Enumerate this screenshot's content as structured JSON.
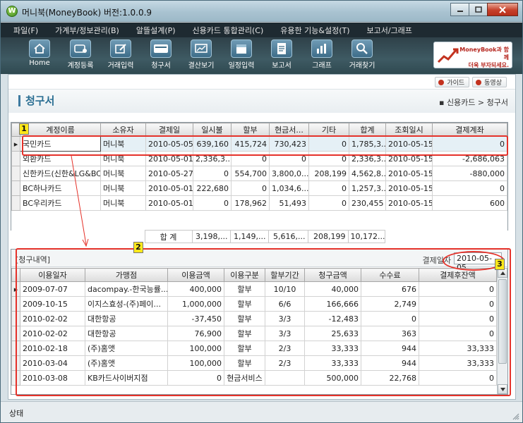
{
  "window": {
    "logo_letter": "W",
    "title": "머니북(MoneyBook) 버전:1.0.0.9"
  },
  "menu": [
    {
      "label": "파일(F)"
    },
    {
      "label": "가계부/정보관리(B)"
    },
    {
      "label": "알뜰설계(P)"
    },
    {
      "label": "신용카드 통합관리(C)"
    },
    {
      "label": "유용한 기능&설정(T)"
    },
    {
      "label": "보고서/그래프"
    }
  ],
  "toolbar": [
    {
      "label": "Home",
      "icon": "home-icon"
    },
    {
      "label": "계정등록",
      "icon": "account-register-icon"
    },
    {
      "label": "거래입력",
      "icon": "edit-icon"
    },
    {
      "label": "청구서",
      "icon": "card-icon"
    },
    {
      "label": "결산보기",
      "icon": "monitor-icon"
    },
    {
      "label": "일정입력",
      "icon": "calendar-icon"
    },
    {
      "label": "보고서",
      "icon": "report-icon"
    },
    {
      "label": "그래프",
      "icon": "bar-chart-icon"
    },
    {
      "label": "거래찾기",
      "icon": "search-icon"
    }
  ],
  "banner": {
    "line1": "MoneyBook과 함께",
    "line2": "더욱 부자되세요."
  },
  "help": {
    "guide": "가이드",
    "video": "동영상"
  },
  "page": {
    "title": "청구서",
    "breadcrumb": "신용카드 > 청구서"
  },
  "bills": {
    "headers": [
      "계정이름",
      "소유자",
      "결제일",
      "일시불",
      "할부",
      "현금서...",
      "기타",
      "합계",
      "조회일시",
      "결제계좌"
    ],
    "rows": [
      [
        "국민카드",
        "머니북",
        "2010-05-05",
        "639,160",
        "415,724",
        "730,423",
        "0",
        "1,785,3...",
        "2010-05-15",
        "0"
      ],
      [
        "외환카드",
        "머니북",
        "2010-05-01",
        "2,336,3...",
        "0",
        "0",
        "0",
        "2,336,3...",
        "2010-05-15",
        "-2,686,063"
      ],
      [
        "신한카드(신한&LG&BC)",
        "머니북",
        "2010-05-27",
        "0",
        "554,700",
        "3,800,0...",
        "208,199",
        "4,562,8...",
        "2010-05-15",
        "-880,000"
      ],
      [
        "BC하나카드",
        "머니북",
        "2010-05-01",
        "222,680",
        "0",
        "1,034,6...",
        "0",
        "1,257,3...",
        "2010-05-15",
        "0"
      ],
      [
        "BC우리카드",
        "머니북",
        "2010-05-01",
        "0",
        "178,962",
        "51,493",
        "0",
        "230,455",
        "2010-05-15",
        "600"
      ]
    ],
    "totals": {
      "label": "합 계",
      "values": [
        "3,198,...",
        "1,149,...",
        "5,616,...",
        "208,199",
        "10,172..."
      ]
    }
  },
  "details": {
    "title": "[청구내역]",
    "due_label": "결제일자",
    "due_date": "2010-05-05",
    "headers": [
      "이용일자",
      "가맹점",
      "이용금액",
      "이용구분",
      "할부기간",
      "청구금액",
      "수수료",
      "결제후잔액"
    ],
    "rows": [
      [
        "2009-07-07",
        "dacompay.-한국능률...",
        "400,000",
        "할부",
        "10/10",
        "40,000",
        "676",
        "0"
      ],
      [
        "2009-10-15",
        "이지스효성-(주)페이...",
        "1,000,000",
        "할부",
        "6/6",
        "166,666",
        "2,749",
        "0"
      ],
      [
        "2010-02-02",
        "대한항공",
        "-37,450",
        "할부",
        "3/3",
        "-12,483",
        "0",
        "0"
      ],
      [
        "2010-02-02",
        "대한항공",
        "76,900",
        "할부",
        "3/3",
        "25,633",
        "363",
        "0"
      ],
      [
        "2010-02-18",
        "(주)홈앳",
        "100,000",
        "할부",
        "2/3",
        "33,333",
        "944",
        "33,333"
      ],
      [
        "2010-03-04",
        "(주)홈앳",
        "100,000",
        "할부",
        "2/3",
        "33,333",
        "944",
        "33,333"
      ],
      [
        "2010-03-08",
        "KB카드사이버지점",
        "0",
        "현금서비스",
        "",
        "500,000",
        "22,768",
        "0"
      ]
    ]
  },
  "status": {
    "text": "상태"
  },
  "annotations": [
    "1",
    "2",
    "3"
  ],
  "colors": {
    "annotation_red": "#e5322a",
    "annotation_badge": "#ffe81a",
    "title_blue": "#2a6e92",
    "menubar_bg": "#1e2a31"
  }
}
